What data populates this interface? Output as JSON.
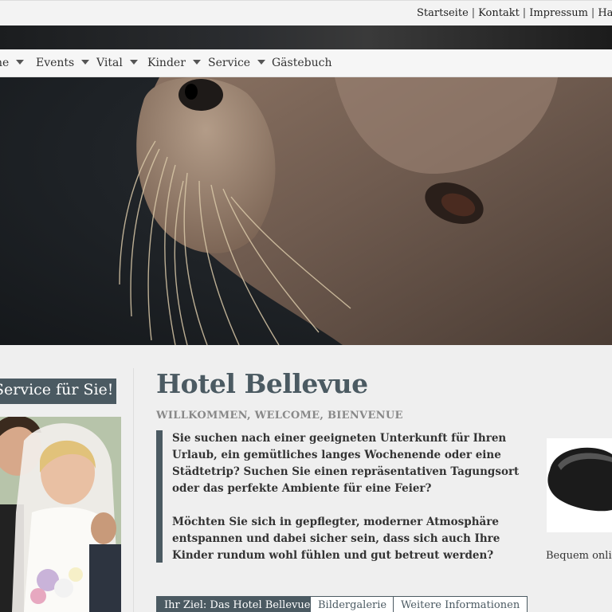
{
  "top_links": [
    "Startseite",
    "Kontakt",
    "Impressum",
    "Haftu"
  ],
  "nav": {
    "items": [
      {
        "label": "ne",
        "has_dropdown": true
      },
      {
        "label": "Events",
        "has_dropdown": true
      },
      {
        "label": "Vital",
        "has_dropdown": true
      },
      {
        "label": "Kinder",
        "has_dropdown": true
      },
      {
        "label": "Service",
        "has_dropdown": true
      },
      {
        "label": "Gästebuch",
        "has_dropdown": false
      }
    ]
  },
  "sidebar": {
    "heading": "Service für Sie!"
  },
  "main": {
    "title": "Hotel Bellevue",
    "subtitle": "WILLKOMMEN, WELCOME, BIENVENUE",
    "paragraph1": "Sie suchen nach einer geeigneten Unterkunft für Ihren Urlaub, ein gemütliches langes Wochenende oder eine Städtetrip? Suchen Sie einen repräsentativen Tagungsort oder das perfekte Ambiente für eine Feier?",
    "paragraph2": "Möchten Sie sich in gepflegter, moderner Atmosphäre entspannen und dabei sicher sein, dass sich auch Ihre Kinder rundum wohl fühlen und gut betreut werden?",
    "tabs": [
      {
        "label": "Ihr Ziel: Das Hotel Bellevue",
        "active": true
      },
      {
        "label": "Bildergalerie",
        "active": false
      },
      {
        "label": "Weitere Informationen",
        "active": false
      }
    ]
  },
  "product": {
    "caption": "Bequem onlin"
  },
  "colors": {
    "accent": "#4b5a62",
    "background": "#efefef"
  }
}
